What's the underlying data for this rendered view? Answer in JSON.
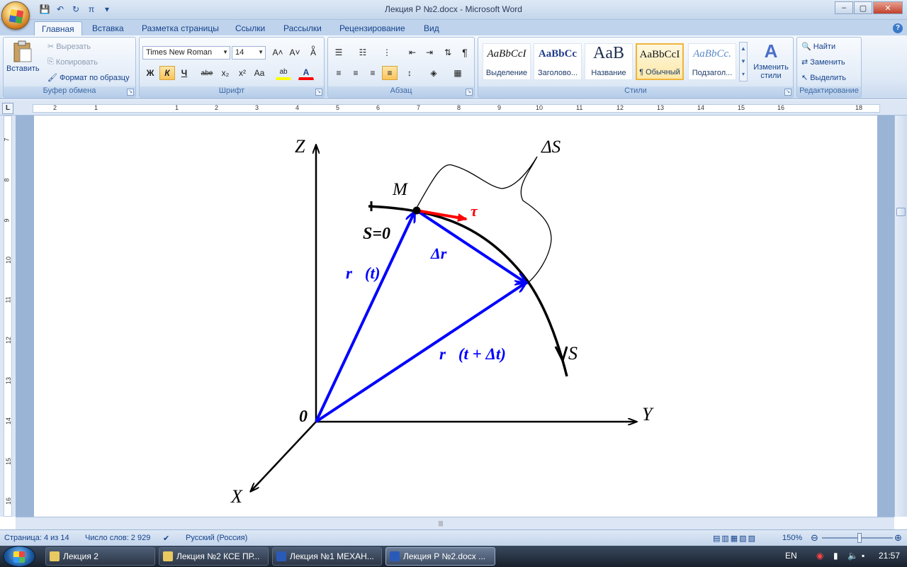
{
  "window": {
    "title": "Лекция Р №2.docx - Microsoft Word",
    "controls": {
      "minimize": "–",
      "maximize": "▢",
      "close": "✕"
    }
  },
  "qat": {
    "save_icon": "💾",
    "undo_icon": "↶",
    "redo_icon": "↻",
    "pi_icon": "π",
    "more_icon": "▾"
  },
  "tabs": [
    "Главная",
    "Вставка",
    "Разметка страницы",
    "Ссылки",
    "Рассылки",
    "Рецензирование",
    "Вид"
  ],
  "ribbon": {
    "clipboard": {
      "label": "Буфер обмена",
      "paste": "Вставить",
      "cut": "Вырезать",
      "copy": "Копировать",
      "format_painter": "Формат по образцу"
    },
    "font": {
      "label": "Шрифт",
      "name": "Times New Roman",
      "size": "14",
      "grow": "A˄",
      "shrink": "A˅",
      "clear": "Aͦ",
      "bold": "Ж",
      "italic": "К",
      "underline": "Ч",
      "strike": "abe",
      "subscript": "x₂",
      "superscript": "x²",
      "case": "Aa",
      "highlight": "ab",
      "color": "A"
    },
    "paragraph": {
      "label": "Абзац",
      "pilcrow": "¶"
    },
    "styles": {
      "label": "Стили",
      "items": [
        {
          "sample": "AaBbCcI",
          "name": "Выделение"
        },
        {
          "sample": "AaBbCc",
          "name": "Заголово..."
        },
        {
          "sample": "AaB",
          "name": "Название"
        },
        {
          "sample": "AaBbCcI",
          "name": "¶ Обычный"
        },
        {
          "sample": "AaBbCc.",
          "name": "Подзагол..."
        }
      ],
      "change_styles": "Изменить стили"
    },
    "editing": {
      "label": "Редактирование",
      "find": "Найти",
      "replace": "Заменить",
      "select": "Выделить"
    }
  },
  "ruler": {
    "corner": "L",
    "labels": [
      "2",
      "1",
      "1",
      "2",
      "3",
      "4",
      "5",
      "6",
      "7",
      "8",
      "9",
      "10",
      "11",
      "12",
      "13",
      "14",
      "15",
      "16",
      "18"
    ],
    "vlabels": [
      "7",
      "8",
      "9",
      "10",
      "11",
      "12",
      "13",
      "14",
      "15",
      "16"
    ]
  },
  "diagram": {
    "axis_z": "Z",
    "axis_y": "Y",
    "axis_x": "X",
    "origin": "0",
    "point_m": "M",
    "delta_s": "ΔS",
    "s_zero": "S=0",
    "s_end": "S",
    "tau": "τ⃗",
    "r_t": "r⃗(t)",
    "delta_r": "Δr⃗",
    "r_t_dt": "r⃗(t + Δt)",
    "colors": {
      "blue": "#0000ff",
      "red": "#ff0000",
      "black": "#000000"
    }
  },
  "status": {
    "page": "Страница: 4 из 14",
    "words": "Число слов: 2 929",
    "lang": "Русский (Россия)",
    "zoom": "150%"
  },
  "taskbar": {
    "items": [
      "Лекция 2",
      "Лекция №2 КСЕ ПР...",
      "Лекция №1 МЕХАН...",
      "Лекция Р №2.docx ..."
    ],
    "lang": "EN",
    "time": "21:57"
  }
}
